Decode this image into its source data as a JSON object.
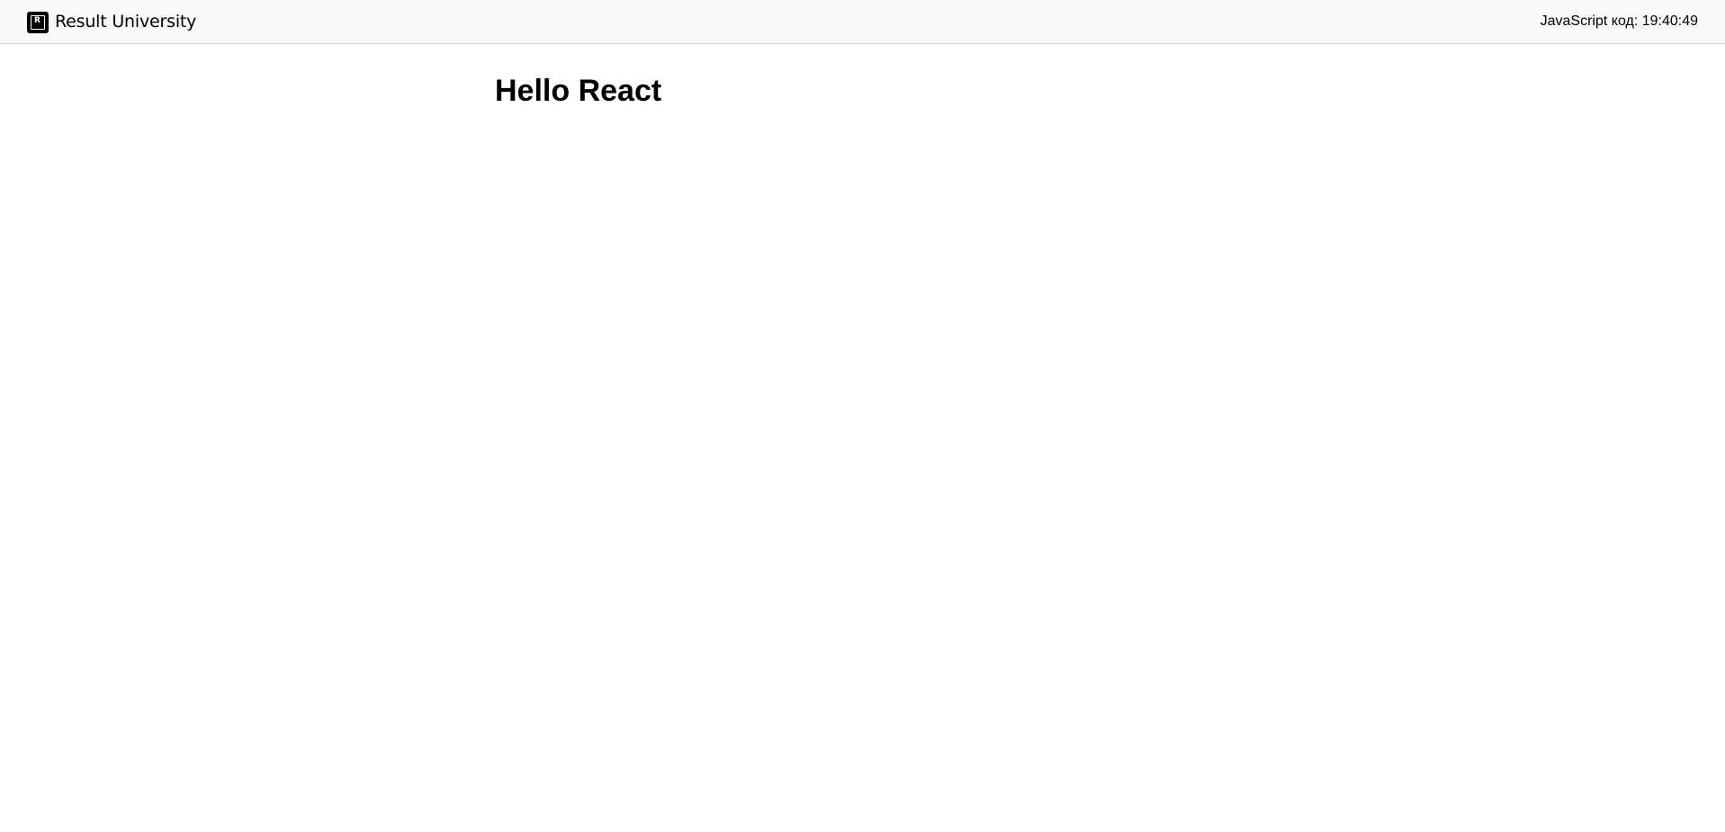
{
  "header": {
    "brand_name": "Result University",
    "logo_letter": "R",
    "logo_icon": "result-university-logo-icon",
    "clock_text": "JavaScript код: 19:40:49"
  },
  "main": {
    "heading": "Hello React"
  },
  "colors": {
    "header_background": "#f9f9f9",
    "header_border": "#cfcfcf",
    "page_background": "#ffffff",
    "text": "#000000"
  }
}
